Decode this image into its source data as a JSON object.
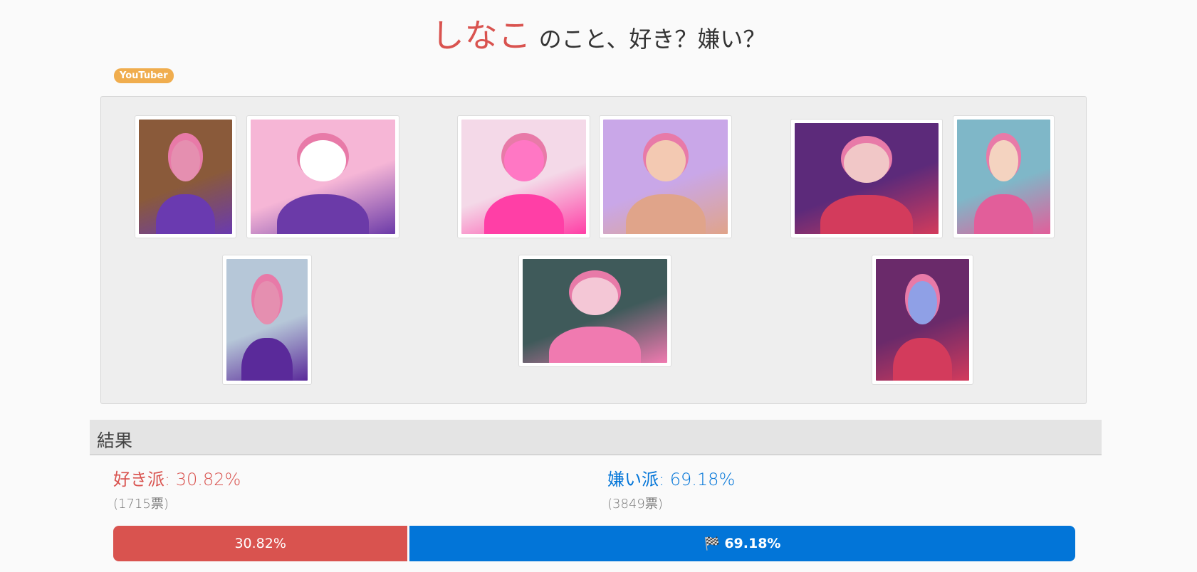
{
  "title": {
    "name": "しなこ",
    "question": "のこと、好き？嫌い？"
  },
  "tag": "YouTuber",
  "gallery": {
    "photos": [
      {
        "id": "photo-1",
        "colors": [
          "#8a5a3a",
          "#6a3ab0",
          "#e58fb0"
        ]
      },
      {
        "id": "photo-2",
        "colors": [
          "#f6b6d6",
          "#6b3aa8",
          "#ffffff"
        ]
      },
      {
        "id": "photo-3",
        "colors": [
          "#f4d9e8",
          "#ff3fa6",
          "#ff77c4"
        ]
      },
      {
        "id": "photo-4",
        "colors": [
          "#c9a7e8",
          "#e0a48a",
          "#f3c9b2"
        ]
      },
      {
        "id": "photo-5",
        "colors": [
          "#5c2a7a",
          "#d33b5c",
          "#f1c7c7"
        ]
      },
      {
        "id": "photo-6",
        "colors": [
          "#7fb7c8",
          "#e25e9a",
          "#f4d3c0"
        ]
      },
      {
        "id": "photo-7",
        "colors": [
          "#b6c7d8",
          "#5a2a9a",
          "#e58fb0"
        ]
      },
      {
        "id": "photo-8",
        "colors": [
          "#3f5a5a",
          "#f07ab0",
          "#f4c7d6"
        ]
      },
      {
        "id": "photo-9",
        "colors": [
          "#6a2a6a",
          "#d33b5c",
          "#8fa0e6"
        ]
      }
    ]
  },
  "result": {
    "heading": "結果",
    "like": {
      "label": "好き派",
      "sep": ":",
      "percent": "30.82%",
      "votes": "(1715票)",
      "value": 30.82,
      "color": "#d9534f"
    },
    "dislike": {
      "label": "嫌い派",
      "sep": ":",
      "percent": "69.18%",
      "votes": "(3849票)",
      "value": 69.18,
      "color": "#0275d8"
    },
    "bar": {
      "like_text": "30.82%",
      "dislike_text": "69.18%",
      "dislike_icon": "flag-icon"
    }
  }
}
